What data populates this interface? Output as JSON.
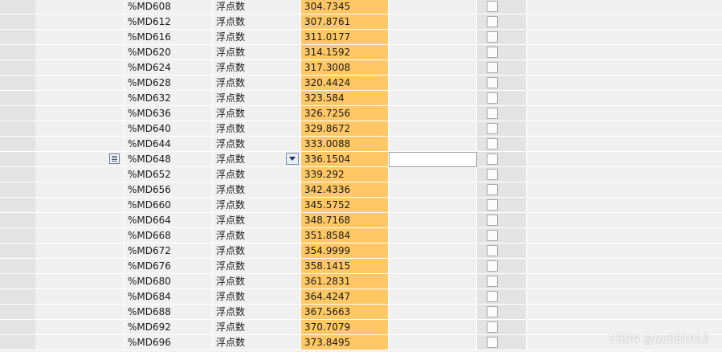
{
  "rows": [
    {
      "address": "%MD608",
      "type": "浮点数",
      "value": "304.7345"
    },
    {
      "address": "%MD612",
      "type": "浮点数",
      "value": "307.8761"
    },
    {
      "address": "%MD616",
      "type": "浮点数",
      "value": "311.0177"
    },
    {
      "address": "%MD620",
      "type": "浮点数",
      "value": "314.1592"
    },
    {
      "address": "%MD624",
      "type": "浮点数",
      "value": "317.3008"
    },
    {
      "address": "%MD628",
      "type": "浮点数",
      "value": "320.4424"
    },
    {
      "address": "%MD632",
      "type": "浮点数",
      "value": "323.584"
    },
    {
      "address": "%MD636",
      "type": "浮点数",
      "value": "326.7256"
    },
    {
      "address": "%MD640",
      "type": "浮点数",
      "value": "329.8672"
    },
    {
      "address": "%MD644",
      "type": "浮点数",
      "value": "333.0088"
    },
    {
      "address": "%MD648",
      "type": "浮点数",
      "value": "336.1504",
      "selected": true
    },
    {
      "address": "%MD652",
      "type": "浮点数",
      "value": "339.292"
    },
    {
      "address": "%MD656",
      "type": "浮点数",
      "value": "342.4336"
    },
    {
      "address": "%MD660",
      "type": "浮点数",
      "value": "345.5752"
    },
    {
      "address": "%MD664",
      "type": "浮点数",
      "value": "348.7168"
    },
    {
      "address": "%MD668",
      "type": "浮点数",
      "value": "351.8584"
    },
    {
      "address": "%MD672",
      "type": "浮点数",
      "value": "354.9999"
    },
    {
      "address": "%MD676",
      "type": "浮点数",
      "value": "358.1415"
    },
    {
      "address": "%MD680",
      "type": "浮点数",
      "value": "361.2831"
    },
    {
      "address": "%MD684",
      "type": "浮点数",
      "value": "364.4247"
    },
    {
      "address": "%MD688",
      "type": "浮点数",
      "value": "367.5663"
    },
    {
      "address": "%MD692",
      "type": "浮点数",
      "value": "370.7079"
    },
    {
      "address": "%MD696",
      "type": "浮点数",
      "value": "373.8495"
    }
  ],
  "modify_value": "",
  "watermark": "CSDN @lzc881012",
  "colors": {
    "value_highlight": "#ffc864",
    "row_background": "#f0f0f0",
    "side_column": "#e3e3e3"
  },
  "icons": {
    "row_menu": "list-icon",
    "display_format": "chevron-down-icon",
    "monitor": "checkbox"
  }
}
